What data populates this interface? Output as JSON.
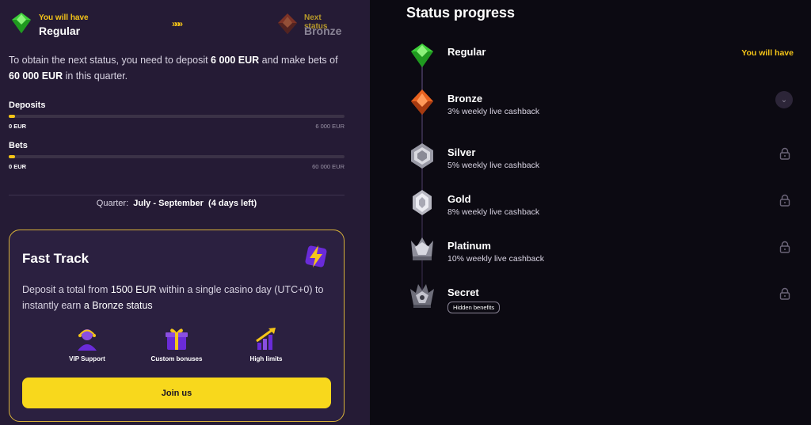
{
  "status_header": {
    "current_label": "You will have",
    "current_status": "Regular",
    "arrows": "»»»",
    "next_label": "Next status",
    "next_status": "Bronze"
  },
  "info": {
    "text_1": "To obtain the next status, you need to deposit ",
    "deposit_amount": "6 000 EUR",
    "text_2": " and make bets of ",
    "bet_amount": "60 000 EUR",
    "text_3": " in this quarter."
  },
  "deposits": {
    "label": "Deposits",
    "min": "0 EUR",
    "max": "6 000 EUR",
    "progress": 0.02
  },
  "bets": {
    "label": "Bets",
    "min": "0 EUR",
    "max": "60 000 EUR",
    "progress": 0.02
  },
  "quarter": {
    "label": "Quarter:",
    "value": "July - September",
    "remaining": "(4 days left)"
  },
  "fast_track": {
    "title": "Fast Track",
    "desc_1": "Deposit a total from ",
    "desc_amount": "1500 EUR",
    "desc_2": " within a single casino day (UTC+0) to instantly earn ",
    "desc_status": "a Bronze status",
    "features": [
      {
        "label": "VIP Support",
        "icon": "vip-support-icon"
      },
      {
        "label": "Custom bonuses",
        "icon": "gift-icon"
      },
      {
        "label": "High limits",
        "icon": "growth-chart-icon"
      }
    ],
    "button": "Join us"
  },
  "status_progress": {
    "title": "Status progress",
    "levels": [
      {
        "name": "Regular",
        "sub": "",
        "badge": "You will have",
        "icon": "green-gem-icon",
        "color": "#3ecf3a"
      },
      {
        "name": "Bronze",
        "sub": "3% weekly live cashback",
        "icon": "orange-gem-icon",
        "color": "#e8621f"
      },
      {
        "name": "Silver",
        "sub": "5% weekly live cashback",
        "icon": "silver-gem-icon",
        "color": "#c9c9d2"
      },
      {
        "name": "Gold",
        "sub": "8% weekly live cashback",
        "icon": "gold-gem-icon",
        "color": "#d8d8de"
      },
      {
        "name": "Platinum",
        "sub": "10% weekly live cashback",
        "icon": "platinum-crown-icon",
        "color": "#b0b0bb"
      },
      {
        "name": "Secret",
        "sub": "Hidden benefits",
        "icon": "secret-crown-icon",
        "color": "#9a9aa6"
      }
    ]
  }
}
